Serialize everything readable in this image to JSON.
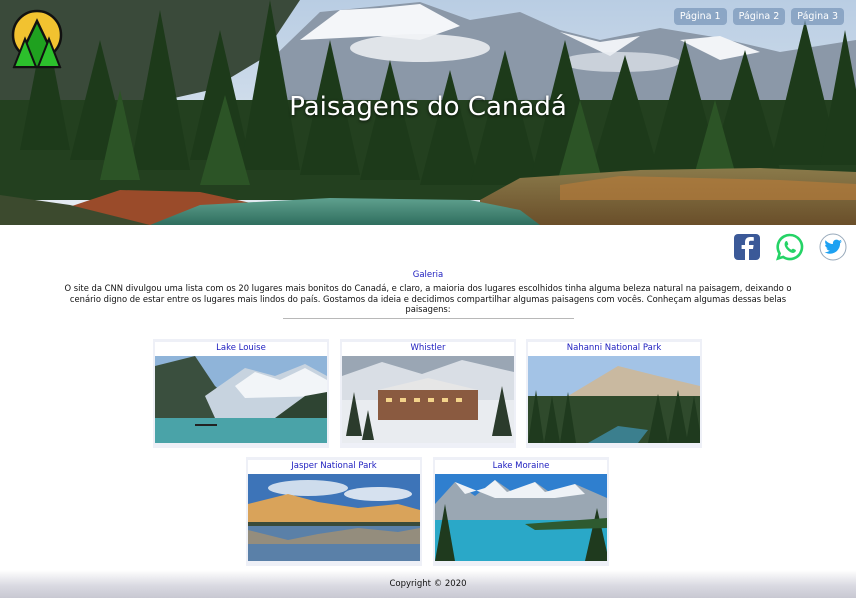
{
  "header": {
    "title": "Paisagens do Canadá",
    "logo_icon": "mountain-logo-icon",
    "nav": [
      {
        "label": "Página 1"
      },
      {
        "label": "Página 2"
      },
      {
        "label": "Página 3"
      }
    ]
  },
  "social": [
    {
      "icon": "facebook-icon",
      "color": "#3b5998"
    },
    {
      "icon": "whatsapp-icon",
      "color": "#25d366"
    },
    {
      "icon": "twitter-icon",
      "color": "#1da1f2"
    }
  ],
  "intro": {
    "link": "Galeria",
    "text": "O site da CNN divulgou uma lista com os 20 lugares mais bonitos do Canadá, e claro, a maioria dos lugares escolhidos tinha alguma beleza natural na paisagem, deixando o cenário digno de estar entre os lugares mais lindos do país. Gostamos da ideia e decidimos compartilhar algumas paisagens com vocês. Conheçam algumas dessas belas paisagens:"
  },
  "gallery": [
    {
      "caption": "Lake Louise"
    },
    {
      "caption": "Whistler"
    },
    {
      "caption": "Nahanni National Park"
    },
    {
      "caption": "Jasper National Park"
    },
    {
      "caption": "Lake Moraine"
    }
  ],
  "footer": {
    "text": "Copyright © 2020"
  },
  "colors": {
    "link": "#1d1dbf",
    "nav_button": "#7896b9",
    "logo_sun": "#f2c230",
    "logo_trees": "#1fa11f"
  }
}
